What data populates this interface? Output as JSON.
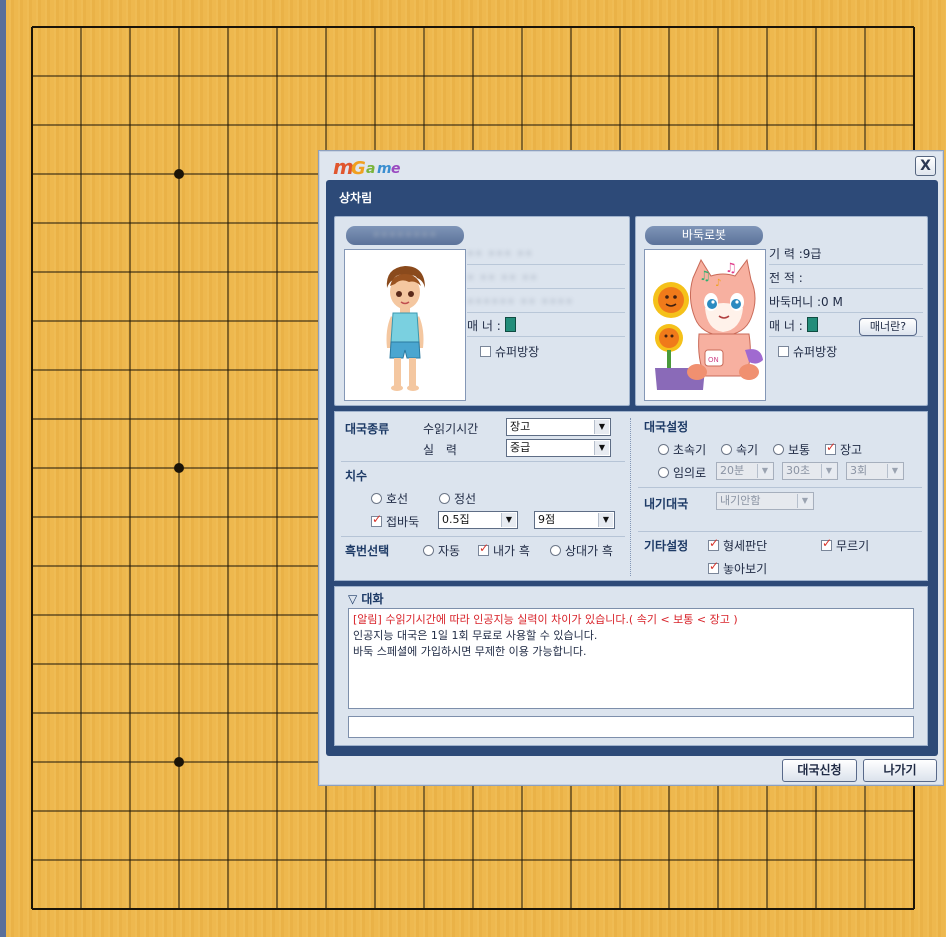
{
  "dialog": {
    "logo_text": "mGame",
    "close_label": "X",
    "section_title": "상차림",
    "player": {
      "name": "••••••••",
      "row1": "•• ••• ••",
      "row2": "• •• •• ••",
      "row3": "•••••• •• ••••",
      "manner_label": "매  너 :",
      "super_room_label": "슈퍼방장"
    },
    "opponent": {
      "name": "바둑로봇",
      "rank_label": "기  력 :",
      "rank_value": "9급",
      "record_label": "전  적 :",
      "money_label": "바둑머니 :",
      "money_value": "0 M",
      "manner_label": "매  너 :",
      "manner_button": "매너란?",
      "super_room_label": "슈퍼방장"
    },
    "game_type": {
      "title": "대국종류",
      "time_label": "수읽기시간",
      "time_value": "장고",
      "skill_label": "실  력",
      "skill_value": "중급"
    },
    "handicap": {
      "title": "치수",
      "opt_even": "호선",
      "opt_fixed": "정선",
      "opt_handicap": "접바둑",
      "komi_value": "0.5집",
      "stones_value": "9점"
    },
    "color_select": {
      "title": "흑번선택",
      "opt_auto": "자동",
      "opt_me_black": "내가 흑",
      "opt_opp_black": "상대가 흑"
    },
    "match_settings": {
      "title": "대국설정",
      "opt_ultra_fast": "초속기",
      "opt_fast": "속기",
      "opt_normal": "보통",
      "opt_long": "장고",
      "opt_custom": "임의로",
      "custom_minutes": "20분",
      "custom_seconds": "30초",
      "custom_count": "3회"
    },
    "bet_match": {
      "title": "내기대국",
      "value": "내기안함"
    },
    "other_settings": {
      "title": "기타설정",
      "opt_evaluation": "형세판단",
      "opt_undo": "무르기",
      "opt_hint": "놓아보기"
    },
    "chat": {
      "title": "▽ 대화",
      "line1": "[알림] 수읽기시간에 따라 인공지능 실력이 차이가 있습니다.( 속기 < 보통 < 장고 )",
      "line2": "인공지능 대국은 1일 1회 무료로 사용할 수 있습니다.",
      "line3": "바둑 스페셜에 가입하시면 무제한 이용 가능합니다."
    },
    "buttons": {
      "request": "대국신청",
      "exit": "나가기"
    }
  },
  "colors": {
    "board": "#edb64a",
    "panel_frame": "#2d4a78",
    "alert_text": "#d8232a",
    "check_mark": "#d8352c"
  }
}
